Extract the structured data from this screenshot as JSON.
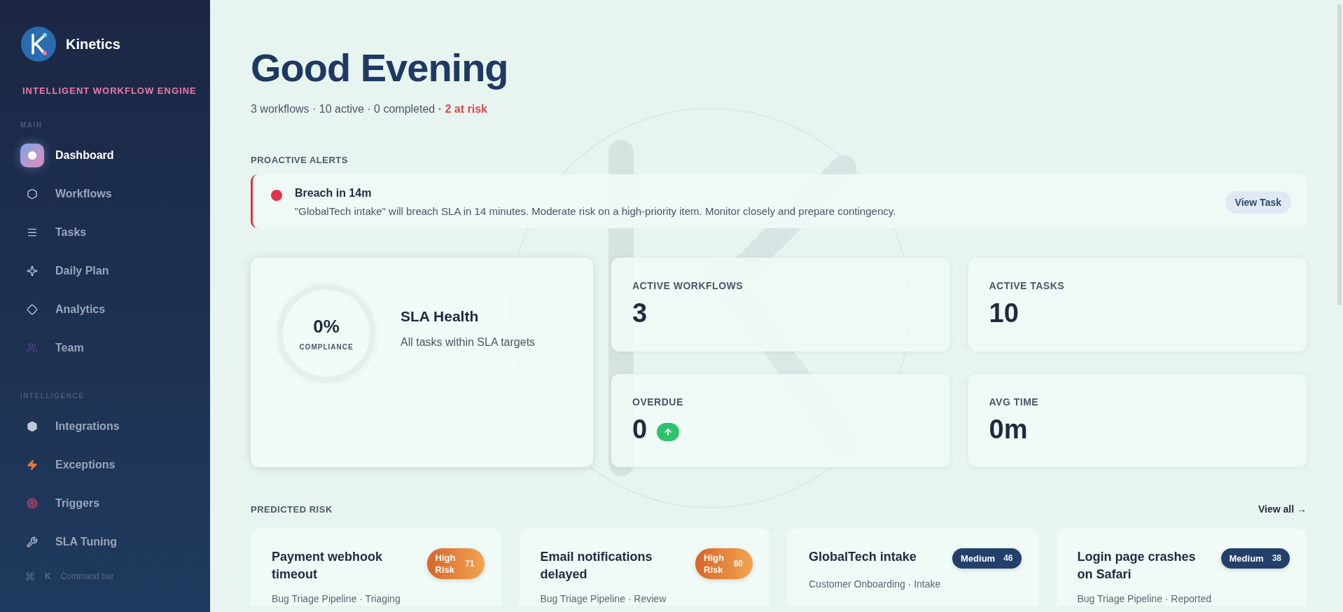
{
  "brand": {
    "name": "Kinetics",
    "tagline": "INTELLIGENT WORKFLOW ENGINE"
  },
  "sidebar": {
    "sections": [
      {
        "title": "MAIN",
        "items": [
          {
            "label": "Dashboard",
            "selected": true
          },
          {
            "label": "Workflows",
            "selected": false
          },
          {
            "label": "Tasks",
            "selected": false
          },
          {
            "label": "Daily Plan",
            "selected": false
          },
          {
            "label": "Analytics",
            "selected": false
          },
          {
            "label": "Team",
            "selected": false
          }
        ]
      },
      {
        "title": "INTELLIGENCE",
        "items": [
          {
            "label": "Integrations",
            "selected": false
          },
          {
            "label": "Exceptions",
            "selected": false
          },
          {
            "label": "Triggers",
            "selected": false
          },
          {
            "label": "SLA Tuning",
            "selected": false
          }
        ]
      }
    ],
    "command_bar": {
      "key": "K",
      "label": "Command bar"
    }
  },
  "header": {
    "title": "Good Evening",
    "summary": "3 workflows · 10 active · 0 completed",
    "risk_note": "· 2 at risk"
  },
  "alerts": {
    "title": "PROACTIVE ALERTS",
    "items": [
      {
        "title": "Breach in 14m",
        "message": "\"GlobalTech intake\" will breach SLA in 14 minutes. Moderate risk on a high-priority item. Monitor closely and prepare contingency.",
        "action": "View Task",
        "color": "#e0334f"
      }
    ]
  },
  "sla": {
    "value": "0%",
    "caption": "COMPLIANCE",
    "title": "SLA Health",
    "subtitle": "All tasks within SLA targets"
  },
  "stats": [
    {
      "label": "ACTIVE WORKFLOWS",
      "value": "3",
      "rising": false
    },
    {
      "label": "ACTIVE TASKS",
      "value": "10",
      "rising": false
    },
    {
      "label": "OVERDUE",
      "value": "0",
      "rising": true
    },
    {
      "label": "AVG TIME",
      "value": "0m",
      "rising": false
    }
  ],
  "risk": {
    "title": "PREDICTED RISK",
    "link": "View all →",
    "items": [
      {
        "title": "Payment webhook timeout",
        "kind": "high",
        "badge": "High Risk",
        "score": "71",
        "meta": "Bug Triage Pipeline · Triaging"
      },
      {
        "title": "Email notifications delayed",
        "kind": "high",
        "badge": "High Risk",
        "score": "60",
        "meta": "Bug Triage Pipeline · Review"
      },
      {
        "title": "GlobalTech intake",
        "kind": "medium",
        "badge": "Medium",
        "score": "46",
        "meta": "Customer Onboarding · Intake"
      },
      {
        "title": "Login page crashes on Safari",
        "kind": "medium",
        "badge": "Medium",
        "score": "38",
        "meta": "Bug Triage Pipeline · Reported"
      }
    ]
  }
}
